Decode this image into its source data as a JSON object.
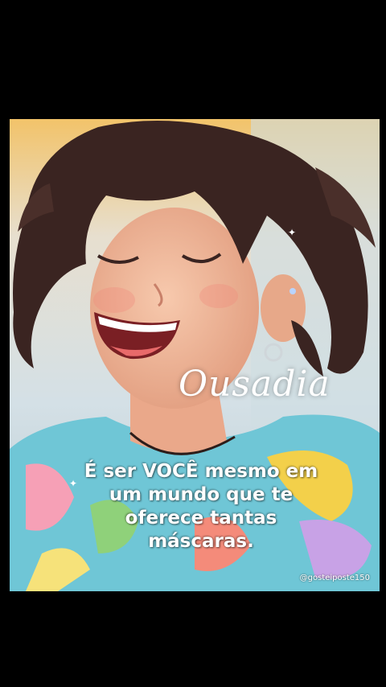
{
  "image": {
    "description_icon": "laughing-woman-illustration"
  },
  "overlay": {
    "title": "Ousadia",
    "quote_lines": [
      "É  ser VOCÊ mesmo em",
      "um  mundo  que te",
      "oferece tantas",
      "máscaras."
    ],
    "watermark": "@gosteiposte150"
  },
  "colors": {
    "background": "#000000",
    "text": "#ffffff",
    "hair": "#3a2421",
    "skin": "#f0b79a"
  }
}
